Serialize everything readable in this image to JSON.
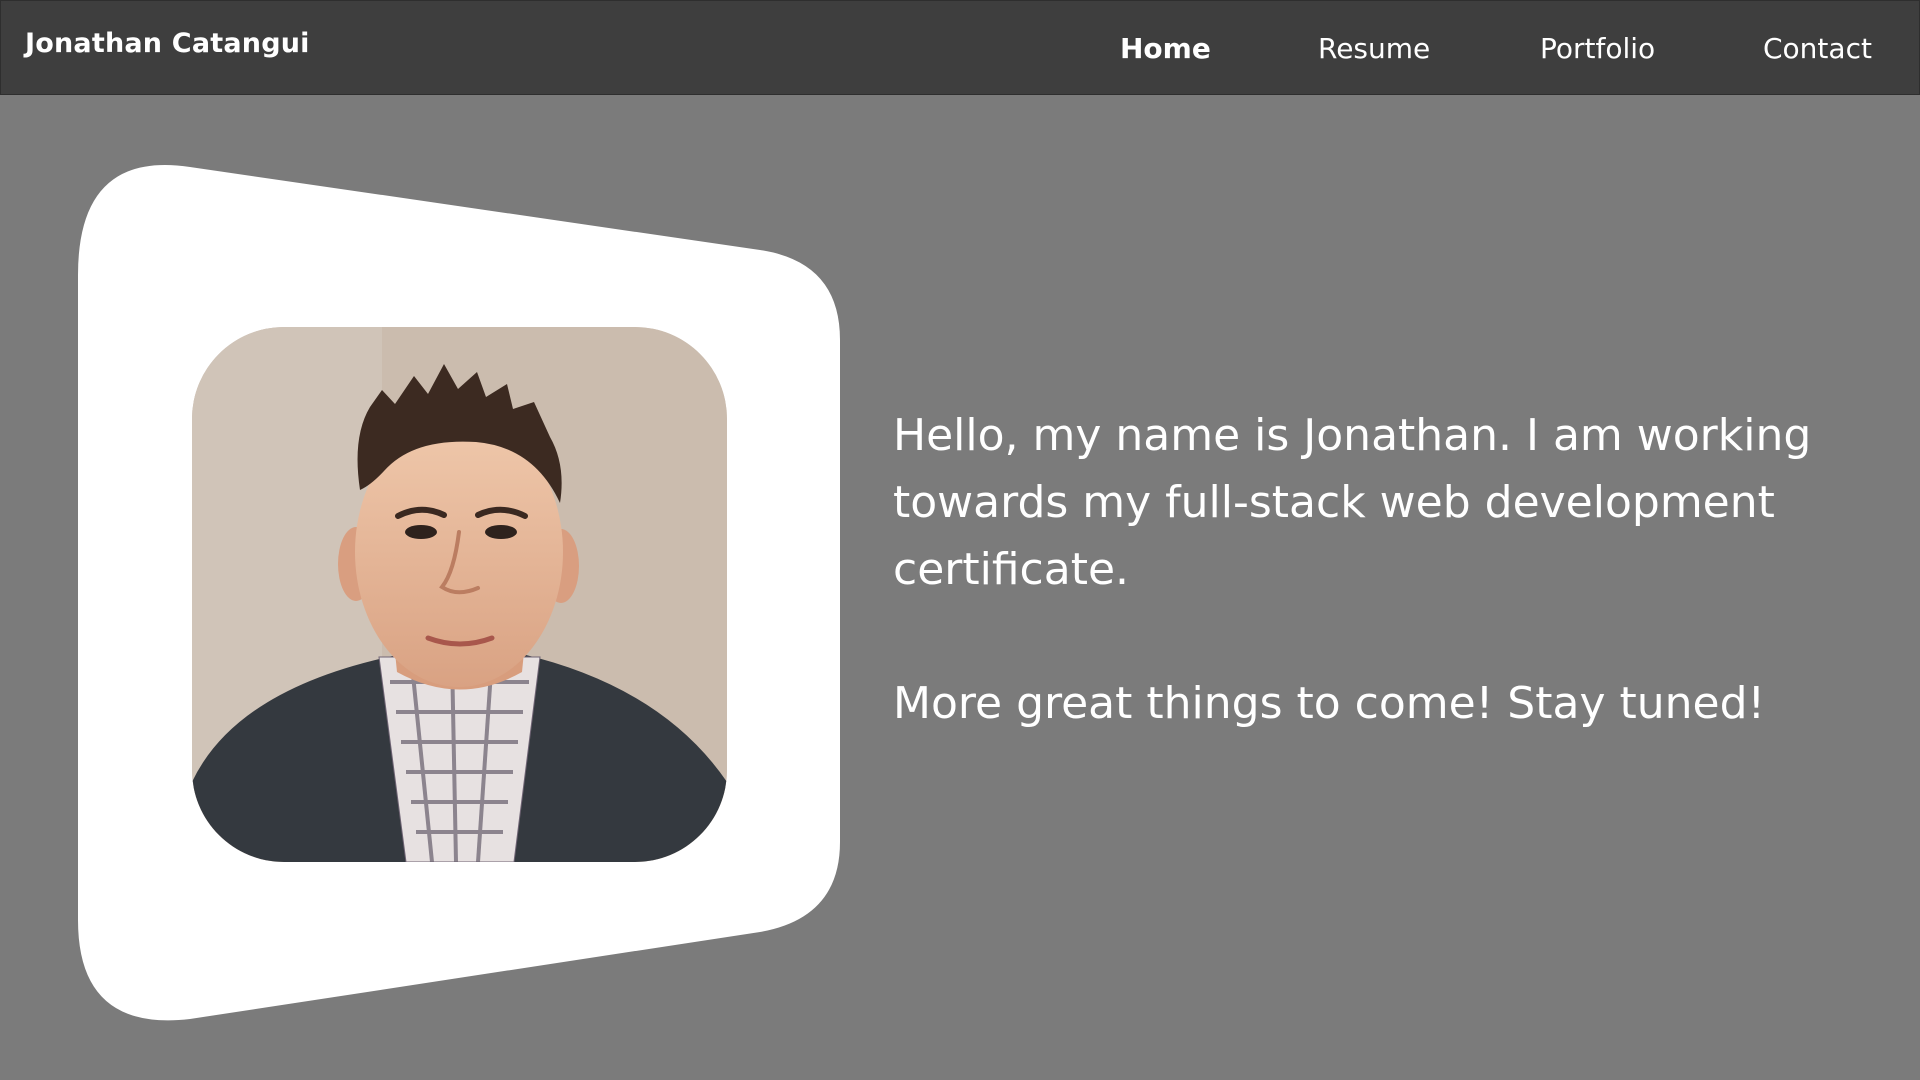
{
  "header": {
    "brand": "Jonathan Catangui",
    "nav": [
      {
        "label": "Home",
        "active": true
      },
      {
        "label": "Resume",
        "active": false
      },
      {
        "label": "Portfolio",
        "active": false
      },
      {
        "label": "Contact",
        "active": false
      }
    ]
  },
  "main": {
    "intro_line_1": "Hello, my name is Jonathan.  I am working towards my full-stack web development certificate.",
    "intro_line_2": "More great things to come!  Stay tuned!"
  },
  "colors": {
    "page_background": "#7b7b7b",
    "navbar_background": "#3e3e3e",
    "frame_fill": "#ffffff",
    "text": "#ffffff"
  }
}
